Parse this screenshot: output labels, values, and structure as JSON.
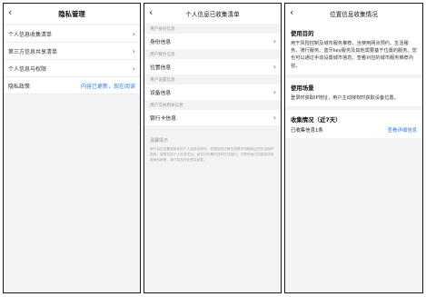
{
  "privacy_panel": {
    "back": "‹",
    "title": "隐私管理",
    "items": [
      {
        "label": "个人信息收集清单",
        "chevron": "›"
      },
      {
        "label": "第三方信息共享清单",
        "chevron": "›"
      },
      {
        "label": "个人信息与权限",
        "chevron": "›"
      }
    ],
    "policy": {
      "label": "隐私政策",
      "status": "内容已更新，现在阅读"
    }
  },
  "collection_panel": {
    "back": "‹",
    "title": "个人信息已收集清单",
    "sections": [
      {
        "header": "用户身份信息",
        "item": "身份信息"
      },
      {
        "header": "用户服务信息",
        "item": "位置信息"
      },
      {
        "header": "用户设置信息",
        "item": "设备信息"
      },
      {
        "header": "用户交易相关信息",
        "item": "银行卡信息"
      }
    ],
    "chevron": "›",
    "tip_title": "温馨提示",
    "tip_text": "我们会在收集使用您的个人信息的同时，依据相关法律法规要求采取相应的安全保护措施，保障您的个人信息安全。如您对收集内容有任何疑问，可联系我们的客服或查看隐私政策，我们将及时处理并回复。"
  },
  "location_panel": {
    "back": "‹",
    "title": "位置信息收集情况",
    "purpose": {
      "title": "使用目的",
      "text": "用于风险控制及城市服务推荐，当使用网点预约、生活服务、骑行服务、蓝牙key服务及其他需要基于位置的服务。您也可以通过手动设置城市信息，查看对应的城市服务推荐内容。"
    },
    "scenario": {
      "title": "使用场景",
      "text": "登录时获取IP地址，用户主动授权时获取设备位置。"
    },
    "stats": {
      "title": "收集情况（近7天）",
      "count": "已收集信息1条",
      "link": "查看详细信息"
    }
  }
}
